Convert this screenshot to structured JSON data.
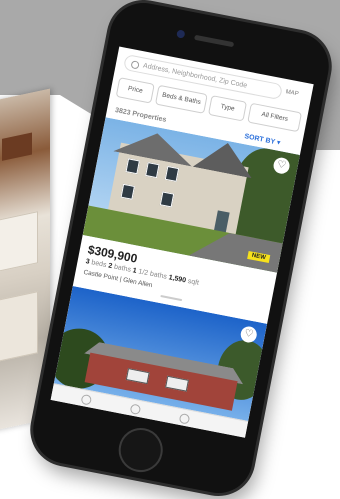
{
  "app": {
    "search": {
      "placeholder": "Address, Neighborhood, Zip Code"
    },
    "map_label": "MAP",
    "filters": [
      {
        "label": "Price"
      },
      {
        "label": "Beds & Baths"
      },
      {
        "label": "Type"
      },
      {
        "label": "All Filters"
      }
    ],
    "results_count": "3823 Properties",
    "sort_label": "SORT BY ▾"
  },
  "listing1": {
    "badge": "NEW",
    "price": "$309,900",
    "beds": "3",
    "beds_label": "beds",
    "baths": "2",
    "baths_label": "baths",
    "half_baths": "1",
    "half_baths_label": "1/2 baths",
    "sqft": "1,590",
    "sqft_label": "sqft",
    "address": "Castle Point | Glen Allen",
    "favorite_icon": "♡"
  },
  "listing2": {
    "favorite_icon": "♡"
  }
}
